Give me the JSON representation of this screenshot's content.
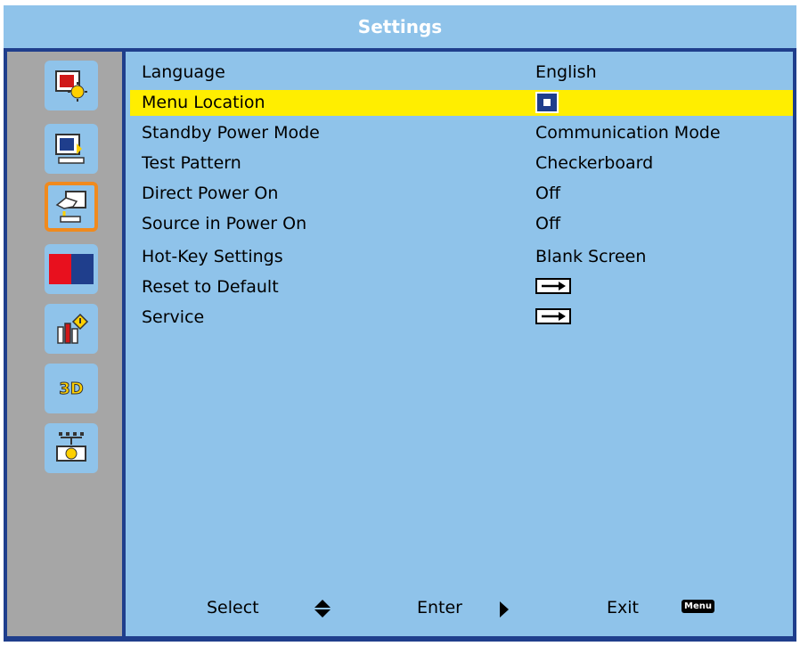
{
  "header": {
    "title": "Settings"
  },
  "sidebar": {
    "items": [
      {
        "icon": "picture-icon",
        "active": false
      },
      {
        "icon": "screen-icon",
        "active": false
      },
      {
        "icon": "settings-hand-icon",
        "active": true
      },
      {
        "icon": "color-icon",
        "active": false
      },
      {
        "icon": "info-icon",
        "active": false
      },
      {
        "icon": "3d-icon",
        "label": "3D",
        "active": false
      },
      {
        "icon": "network-icon",
        "active": false
      }
    ]
  },
  "menu": {
    "rows": [
      {
        "label": "Language",
        "value": "English"
      },
      {
        "label": "Menu Location",
        "value_icon": "menu-location-center-icon",
        "selected": true
      },
      {
        "label": "Standby Power Mode",
        "value": "Communication Mode"
      },
      {
        "label": "Test Pattern",
        "value": "Checkerboard"
      },
      {
        "label": "Direct Power On",
        "value": "Off"
      },
      {
        "label": "Source in Power On",
        "value": "Off"
      },
      {
        "label": "Hot-Key Settings",
        "value": "Blank Screen"
      },
      {
        "label": "Reset to Default",
        "value_icon": "enter-arrow-icon"
      },
      {
        "label": "Service",
        "value_icon": "enter-arrow-icon"
      }
    ]
  },
  "footer": {
    "select_label": "Select",
    "enter_label": "Enter",
    "exit_label": "Exit",
    "menu_key": "Menu"
  },
  "colors": {
    "panel": "#8fc3ea",
    "frame": "#1f3e8c",
    "highlight": "#ffee00",
    "active_border": "#f08a1e",
    "sidebar": "#a6a6a6"
  }
}
